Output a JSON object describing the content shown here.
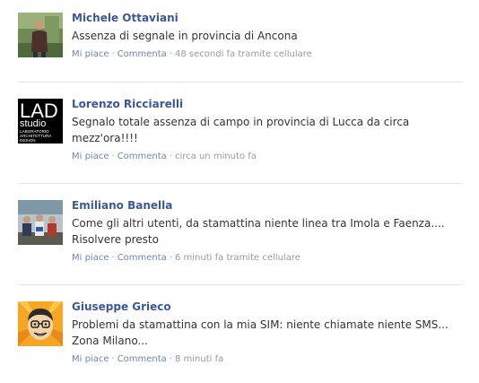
{
  "comments": [
    {
      "author": "Michele Ottaviani",
      "text": "Assenza di segnale in provincia di Ancona",
      "like_label": "Mi piace",
      "comment_label": "Commenta",
      "separator": "·",
      "timestamp": "48 secondi fa tramite cellulare"
    },
    {
      "author": "Lorenzo Ricciarelli",
      "text": "Segnalo totale assenza di campo in provincia di Lucca da circa mezz'ora!!!!",
      "like_label": "Mi piace",
      "comment_label": "Commenta",
      "separator": "·",
      "timestamp": "circa un minuto fa",
      "avatar_logo": {
        "big": "LAD",
        "small": "studio",
        "lines": [
          "LABORATORIO",
          "ARCHITETTURA",
          "DESIGN"
        ]
      }
    },
    {
      "author": "Emiliano Banella",
      "text": "Come gli altri utenti, da stamattina niente linea tra Imola e Faenza.... Risolvere presto",
      "like_label": "Mi piace",
      "comment_label": "Commenta",
      "separator": "·",
      "timestamp": "6 minuti fa tramite cellulare"
    },
    {
      "author": "Giuseppe Grieco",
      "text": "Problemi da stamattina con la mia SIM: niente chiamate niente SMS... Zona Milano...",
      "like_label": "Mi piace",
      "comment_label": "Commenta",
      "separator": "·",
      "timestamp": "8 minuti fa"
    }
  ],
  "colors": {
    "link": "#3b5998",
    "action_link": "#6d84b4",
    "meta_text": "#999999",
    "body_text": "#333333",
    "divider": "#e5e5e5"
  }
}
